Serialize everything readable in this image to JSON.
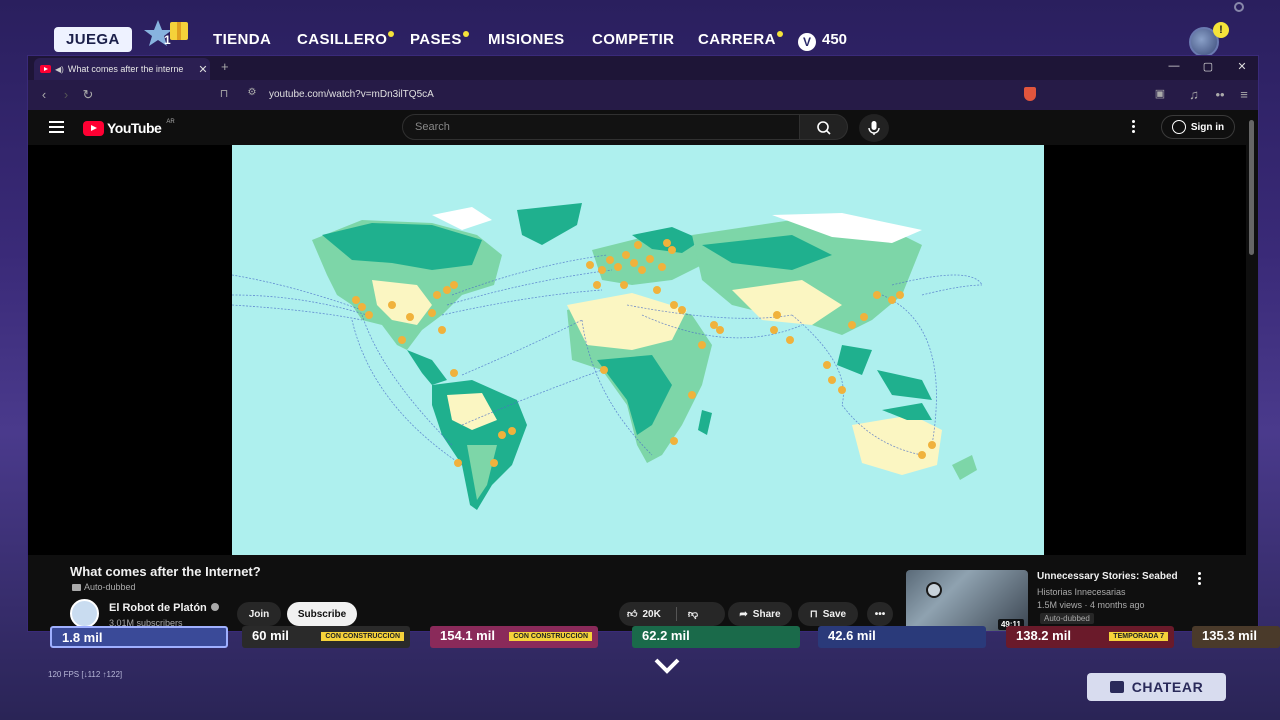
{
  "game": {
    "tabs": [
      {
        "label": "JUEGA"
      },
      {
        "label": "TIENDA"
      },
      {
        "label": "CASILLERO"
      },
      {
        "label": "PASES"
      },
      {
        "label": "MISIONES"
      },
      {
        "label": "COMPETIR"
      },
      {
        "label": "CARRERA"
      }
    ],
    "gift_badge": "1",
    "vbucks": "450",
    "alert_badge": "!",
    "tiles": [
      {
        "label": "1.8 mil",
        "color": "#3a4a98"
      },
      {
        "label": "60 mil",
        "color": "#2a2a2a",
        "tag": "CON CONSTRUCCIÓN"
      },
      {
        "label": "154.1 mil",
        "color": "#8a2a5a",
        "tag": "CON CONSTRUCCIÓN"
      },
      {
        "label": "62.2 mil",
        "color": "#1a6a4a"
      },
      {
        "label": "42.6 mil",
        "color": "#2a3a7a"
      },
      {
        "label": "138.2 mil",
        "color": "#6a1a2a",
        "tag": "TEMPORADA 7"
      },
      {
        "label": "135.3 mil",
        "color": "#4a3a2a"
      }
    ],
    "fps": "120 FPS [↓112 ↑122]",
    "chat_label": "CHATEAR"
  },
  "browser": {
    "tab_title": "What comes after the interne",
    "url": "youtube.com/watch?v=mDn3ilTQ5cA"
  },
  "youtube": {
    "logo_text": "YouTube",
    "country": "AR",
    "search_placeholder": "Search",
    "signin": "Sign in",
    "video": {
      "title": "What comes after the Internet?",
      "dub_label": "Auto-dubbed",
      "channel": "El Robot de Platón",
      "subscribers": "3.01M subscribers",
      "join": "Join",
      "subscribe": "Subscribe",
      "likes": "20K",
      "share": "Share",
      "save": "Save"
    },
    "recommendation": {
      "title": "Unnecessary Stories: Seabed",
      "channel": "Historias Innecesarias",
      "meta": "1.5M views · 4 months ago",
      "dub": "Auto-dubbed",
      "duration": "49:11"
    }
  },
  "colors": {
    "ocean": "#aef0ee",
    "land_dark": "#1fb08e",
    "land_mid": "#7dd6a8",
    "land_light": "#fbf6c2",
    "ice": "#ffffff",
    "node": "#f0b23c",
    "cable": "#4a6ec8",
    "youtube_red": "#ff0033"
  }
}
